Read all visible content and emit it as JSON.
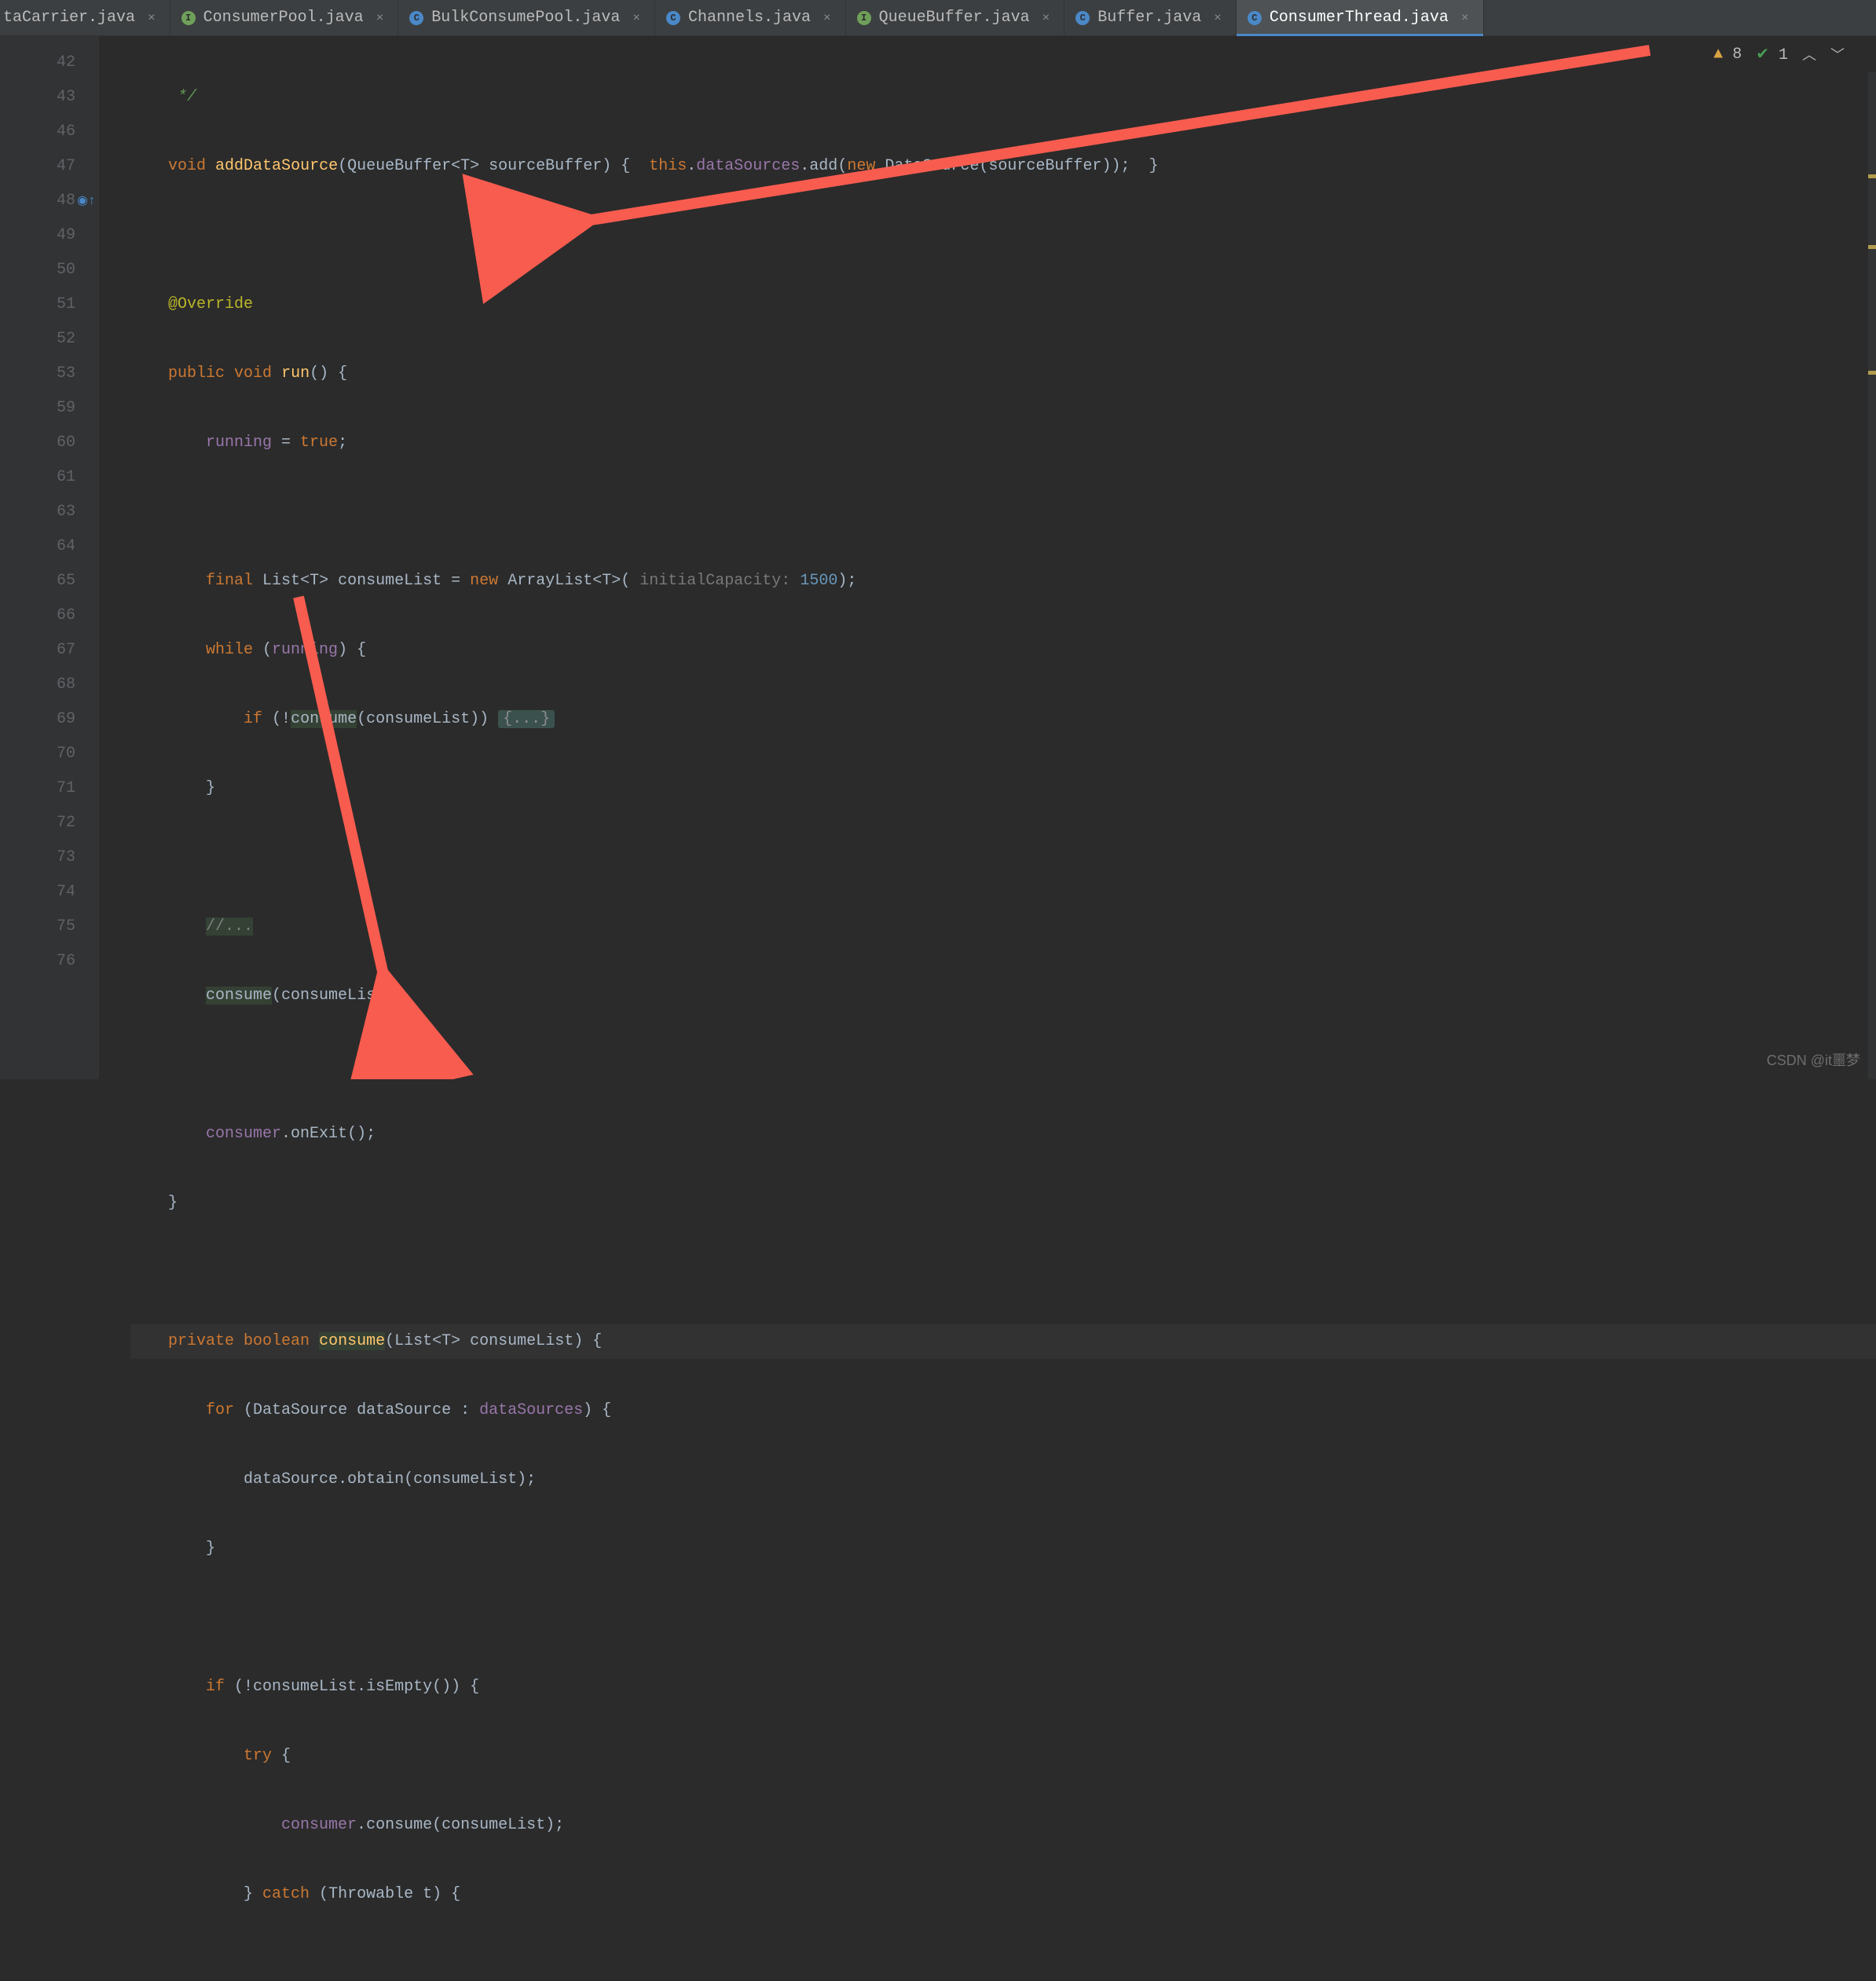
{
  "tabs": [
    {
      "label": "taCarrier.java",
      "icon": "",
      "active": false,
      "partial": true
    },
    {
      "label": "ConsumerPool.java",
      "icon": "i",
      "active": false
    },
    {
      "label": "BulkConsumePool.java",
      "icon": "c",
      "active": false
    },
    {
      "label": "Channels.java",
      "icon": "c",
      "active": false
    },
    {
      "label": "QueueBuffer.java",
      "icon": "i",
      "active": false
    },
    {
      "label": "Buffer.java",
      "icon": "c",
      "active": false
    },
    {
      "label": "ConsumerThread.java",
      "icon": "c",
      "active": true
    }
  ],
  "gutter": [
    "42",
    "43",
    "46",
    "47",
    "48",
    "49",
    "50",
    "51",
    "52",
    "53",
    "59",
    "60",
    "61",
    "63",
    "64",
    "65",
    "66",
    "67",
    "68",
    "69",
    "70",
    "71",
    "72",
    "73",
    "74",
    "75",
    "76"
  ],
  "code": {
    "l42": "*/",
    "l43_kw1": "void",
    "l43_m": "addDataSource",
    "l43_p1": "QueueBuffer",
    "l43_g": "T",
    "l43_p2": "sourceBuffer",
    "l43_this": "this",
    "l43_f": "dataSources",
    "l43_add": "add",
    "l43_new": "new",
    "l43_ds": "DataSource",
    "l43_arg": "sourceBuffer",
    "l47_ann": "@Override",
    "l48_pub": "public",
    "l48_void": "void",
    "l48_run": "run",
    "l49_f": "running",
    "l49_true": "true",
    "l51_final": "final",
    "l51_list": "List",
    "l51_t": "T",
    "l51_var": "consumeList",
    "l51_new": "new",
    "l51_al": "ArrayList",
    "l51_t2": "T",
    "l51_hint": " initialCapacity: ",
    "l51_num": "1500",
    "l52_while": "while",
    "l52_run": "running",
    "l53_if": "if",
    "l53_cons": "consume",
    "l53_arg": "consumeList",
    "l53_fold": "{...}",
    "l61_c": "//...",
    "l63_m": "consume",
    "l63_arg": "consumeList",
    "l65_f": "consumer",
    "l65_m": "onExit",
    "l68_priv": "private",
    "l68_bool": "boolean",
    "l68_m": "consume",
    "l68_list": "List",
    "l68_t": "T",
    "l68_p": "consumeList",
    "l69_for": "for",
    "l69_ds": "DataSource",
    "l69_var": "dataSource",
    "l69_f": "dataSources",
    "l70_var": "dataSource",
    "l70_m": "obtain",
    "l70_arg": "consumeList",
    "l73_if": "if",
    "l73_var": "consumeList",
    "l73_m": "isEmpty",
    "l74_try": "try",
    "l75_f": "consumer",
    "l75_m": "consume",
    "l75_arg": "consumeList",
    "l76_catch": "catch",
    "l76_t": "Throwable",
    "l76_v": "t"
  },
  "inspections": {
    "warnings": "8",
    "checks": "1"
  },
  "watermark": "CSDN @it噩梦"
}
